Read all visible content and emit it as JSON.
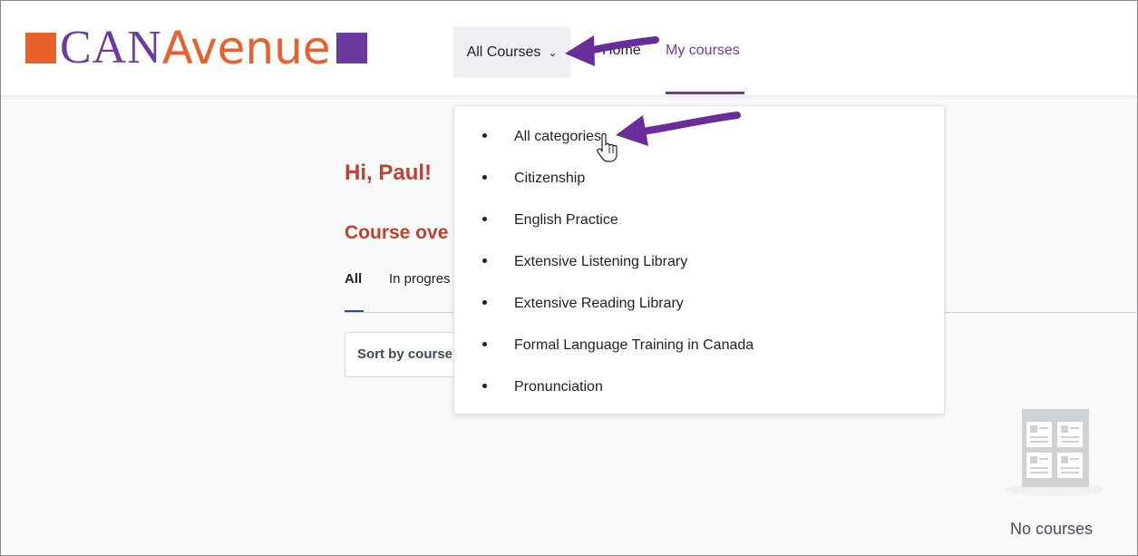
{
  "header": {
    "logo": {
      "prefix": "CAN",
      "suffix": "Avenue"
    },
    "nav": {
      "all_courses": "All Courses",
      "home": "Home",
      "my_courses": "My courses"
    }
  },
  "dropdown": {
    "items": [
      "All categories",
      "Citizenship",
      "English Practice",
      "Extensive Listening Library",
      "Extensive Reading Library",
      "Formal Language Training in Canada",
      "Pronunciation"
    ]
  },
  "main": {
    "greeting": "Hi, Paul!",
    "section_title": "Course ove",
    "tabs": {
      "all": "All",
      "in_progress": "In progres"
    },
    "sort_label": "Sort by course",
    "empty_state": "No courses"
  },
  "colors": {
    "brand_purple": "#6b3aa0",
    "brand_orange": "#e8602c",
    "heading_red": "#c2402e",
    "annotation_arrow": "#6a2c9a"
  },
  "icons": {
    "dropdown_chevron": "chevron-down-icon",
    "cursor": "hand-pointer-icon",
    "empty_state": "course-grid-icon"
  }
}
